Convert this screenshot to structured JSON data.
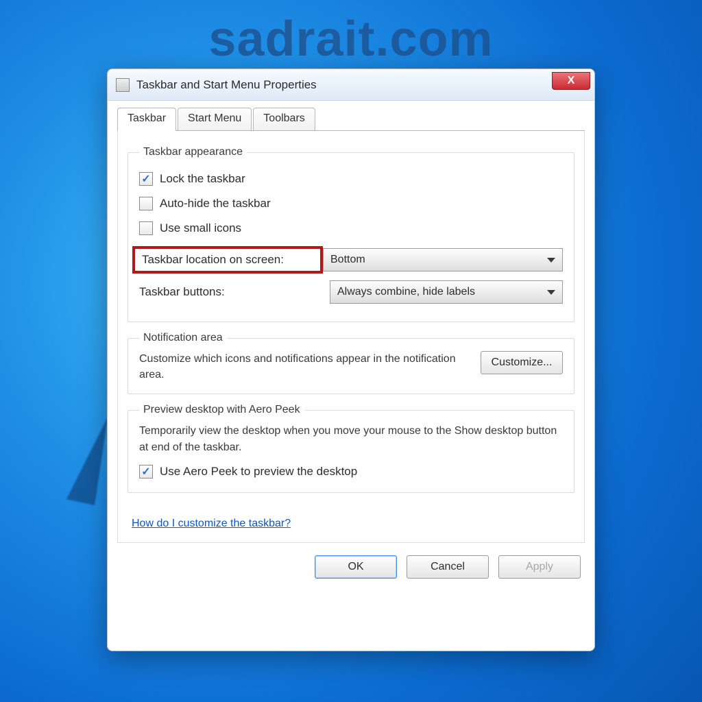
{
  "watermark": "sadrait.com",
  "window": {
    "title": "Taskbar and Start Menu Properties",
    "close_label": "X"
  },
  "tabs": [
    {
      "label": "Taskbar",
      "active": true
    },
    {
      "label": "Start Menu",
      "active": false
    },
    {
      "label": "Toolbars",
      "active": false
    }
  ],
  "appearance": {
    "legend": "Taskbar appearance",
    "lock_label": "Lock the taskbar",
    "lock_checked": true,
    "autohide_label": "Auto-hide the taskbar",
    "autohide_checked": false,
    "smallicons_label": "Use small icons",
    "smallicons_checked": false,
    "location_label": "Taskbar location on screen:",
    "location_value": "Bottom",
    "buttons_label": "Taskbar buttons:",
    "buttons_value": "Always combine, hide labels"
  },
  "notification": {
    "legend": "Notification area",
    "desc": "Customize which icons and notifications appear in the notification area.",
    "customize_label": "Customize..."
  },
  "aero": {
    "legend": "Preview desktop with Aero Peek",
    "desc": "Temporarily view the desktop when you move your mouse to the Show desktop button at end of the taskbar.",
    "checkbox_label": "Use Aero Peek to preview the desktop",
    "checkbox_checked": true
  },
  "help_link": "How do I customize the taskbar?",
  "footer": {
    "ok": "OK",
    "cancel": "Cancel",
    "apply": "Apply"
  }
}
